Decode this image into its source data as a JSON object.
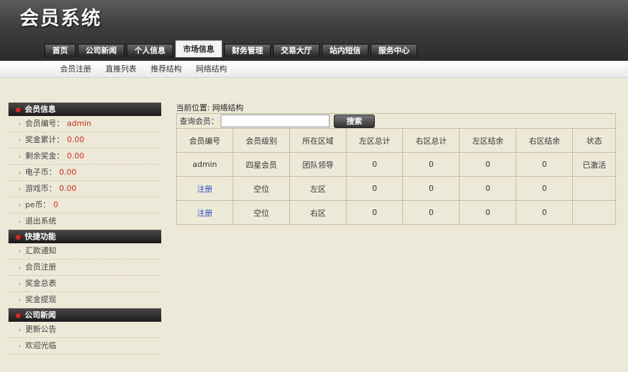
{
  "header": {
    "title": "会员系统"
  },
  "topnav": [
    "首页",
    "公司新闻",
    "个人信息",
    "市场信息",
    "财务管理",
    "交易大厅",
    "站内短信",
    "服务中心"
  ],
  "active_tab_index": 3,
  "subnav": [
    "会员注册",
    "直推列表",
    "推荐结构",
    "网络结构"
  ],
  "sidebar": {
    "member_info": {
      "title": "会员信息",
      "items": [
        {
          "label": "会员编号：",
          "value": "admin"
        },
        {
          "label": "奖金累计：",
          "value": "0.00"
        },
        {
          "label": "剩余奖金：",
          "value": "0.00"
        },
        {
          "label": "电子币：",
          "value": "0.00"
        },
        {
          "label": "游戏币：",
          "value": "0.00"
        },
        {
          "label": "pe币：",
          "value": "0"
        },
        {
          "label": "退出系统",
          "value": ""
        }
      ]
    },
    "shortcuts": {
      "title": "快捷功能",
      "items": [
        "汇款通知",
        "会员注册",
        "奖金总表",
        "奖金提现"
      ]
    },
    "news": {
      "title": "公司新闻",
      "items": [
        "更新公告",
        "欢迎光临"
      ]
    }
  },
  "main": {
    "breadcrumb": "当前位置: 网络结构",
    "search": {
      "label": "查询会员：",
      "value": "",
      "button": "搜索"
    },
    "table": {
      "headers": [
        "会员编号",
        "会员级别",
        "所在区域",
        "左区总计",
        "右区总计",
        "左区结余",
        "右区结余",
        "状态"
      ],
      "rows": [
        [
          "admin",
          "四星会员",
          "团队领导",
          "0",
          "0",
          "0",
          "0",
          "已激活"
        ],
        [
          "注册",
          "空位",
          "左区",
          "0",
          "0",
          "0",
          "0",
          ""
        ],
        [
          "注册",
          "空位",
          "右区",
          "0",
          "0",
          "0",
          "0",
          ""
        ]
      ]
    }
  }
}
